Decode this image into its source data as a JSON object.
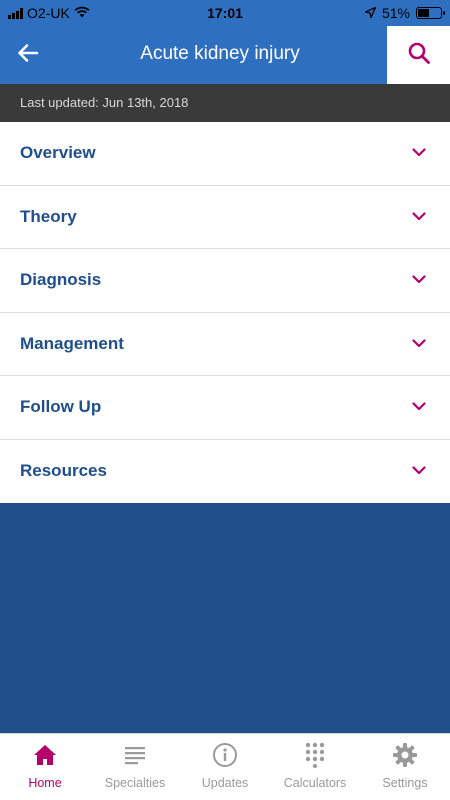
{
  "status_bar": {
    "carrier": "O2-UK",
    "time": "17:01",
    "battery_percent": "51%",
    "battery_level": 0.51
  },
  "header": {
    "title": "Acute kidney injury",
    "back_icon": "arrow-left-icon",
    "search_icon": "search-icon"
  },
  "updated": {
    "text": "Last updated: Jun 13th, 2018"
  },
  "sections": [
    {
      "label": "Overview"
    },
    {
      "label": "Theory"
    },
    {
      "label": "Diagnosis"
    },
    {
      "label": "Management"
    },
    {
      "label": "Follow Up"
    },
    {
      "label": "Resources"
    }
  ],
  "tabs": [
    {
      "label": "Home",
      "icon": "home-icon",
      "active": true
    },
    {
      "label": "Specialties",
      "icon": "list-icon",
      "active": false
    },
    {
      "label": "Updates",
      "icon": "info-icon",
      "active": false
    },
    {
      "label": "Calculators",
      "icon": "keypad-icon",
      "active": false
    },
    {
      "label": "Settings",
      "icon": "gear-icon",
      "active": false
    }
  ],
  "colors": {
    "header_blue": "#2f6fc0",
    "background_blue": "#1f5089",
    "accent_magenta": "#b3006b",
    "section_text": "#1f4f8a"
  }
}
